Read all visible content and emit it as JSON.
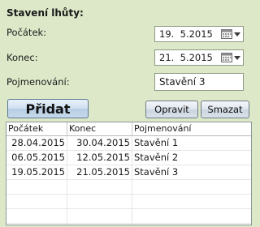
{
  "section_title": "Stavení lhůty:",
  "start": {
    "label": "Počátek:",
    "value": "19.  5.2015"
  },
  "end": {
    "label": "Konec:",
    "value": "21.  5.2015"
  },
  "name": {
    "label": "Pojmenování:",
    "value": "Stavění 3"
  },
  "buttons": {
    "add": "Přidat",
    "edit": "Opravit",
    "delete": "Smazat"
  },
  "grid": {
    "columns": [
      "Počátek",
      "Konec",
      "Pojmenování"
    ],
    "rows": [
      [
        "28.04.2015",
        "30.04.2015",
        "Stavění 1"
      ],
      [
        "06.05.2015",
        "12.05.2015",
        "Stavění 2"
      ],
      [
        "19.05.2015",
        "21.05.2015",
        "Stavění 3"
      ]
    ]
  },
  "icons": {
    "calendar": "calendar-icon",
    "dropdown": "chevron-down-icon"
  }
}
